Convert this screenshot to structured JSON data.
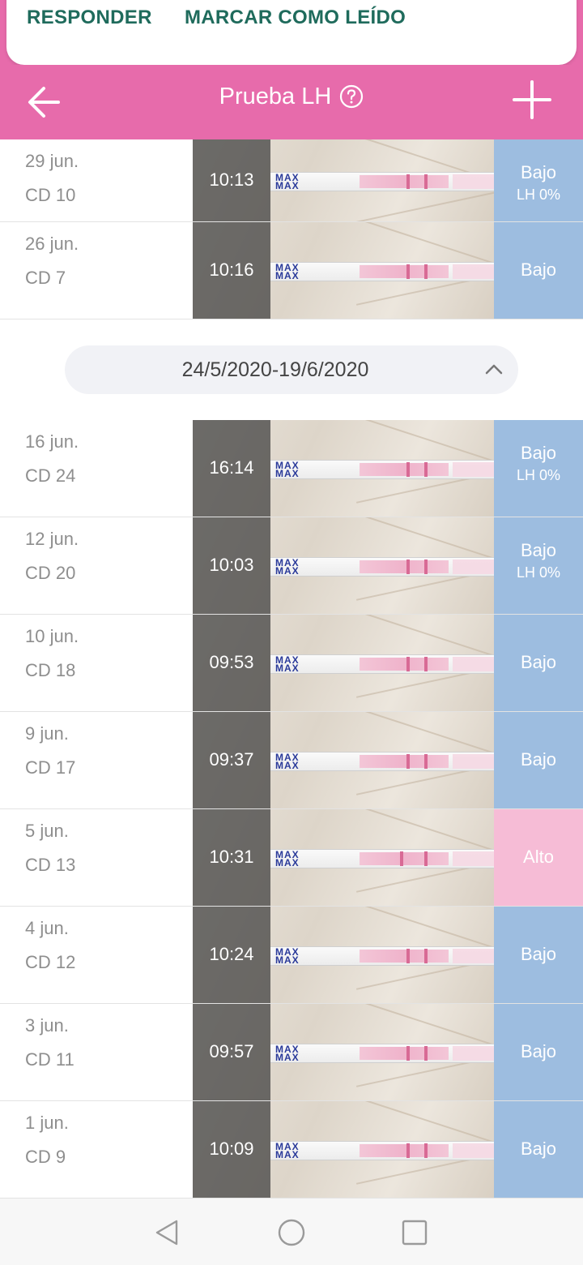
{
  "notification": {
    "reply_label": "RESPONDER",
    "mark_read_label": "MARCAR COMO LEÍDO"
  },
  "header": {
    "title": "Prueba LH",
    "accent_color": "#e76bab"
  },
  "top_entries": [
    {
      "date": "29 jun.",
      "cd": "CD 10",
      "time": "10:13",
      "result": "Bajo",
      "lh": "LH 0%"
    },
    {
      "date": "26 jun.",
      "cd": "CD 7",
      "time": "10:16",
      "result": "Bajo",
      "lh": ""
    }
  ],
  "period": {
    "label": "24/5/2020-19/6/2020"
  },
  "entries": [
    {
      "date": "16 jun.",
      "cd": "CD 24",
      "time": "16:14",
      "result": "Bajo",
      "lh": "LH 0%"
    },
    {
      "date": "12 jun.",
      "cd": "CD 20",
      "time": "10:03",
      "result": "Bajo",
      "lh": "LH 0%"
    },
    {
      "date": "10 jun.",
      "cd": "CD 18",
      "time": "09:53",
      "result": "Bajo",
      "lh": ""
    },
    {
      "date": "9 jun.",
      "cd": "CD 17",
      "time": "09:37",
      "result": "Bajo",
      "lh": ""
    },
    {
      "date": "5 jun.",
      "cd": "CD 13",
      "time": "10:31",
      "result": "Alto",
      "lh": ""
    },
    {
      "date": "4 jun.",
      "cd": "CD 12",
      "time": "10:24",
      "result": "Bajo",
      "lh": ""
    },
    {
      "date": "3 jun.",
      "cd": "CD 11",
      "time": "09:57",
      "result": "Bajo",
      "lh": ""
    },
    {
      "date": "1 jun.",
      "cd": "CD 9",
      "time": "10:09",
      "result": "Bajo",
      "lh": ""
    }
  ],
  "colors": {
    "low_result": "#9dbde0",
    "high_result": "#f6bcd6",
    "action_text": "#1f6b5c"
  },
  "icons": {
    "back": "arrow-left-icon",
    "help": "question-circle-icon",
    "add": "plus-icon",
    "collapse": "chevron-up-icon",
    "nav_back": "triangle-back-icon",
    "nav_home": "circle-home-icon",
    "nav_recents": "square-recents-icon"
  }
}
